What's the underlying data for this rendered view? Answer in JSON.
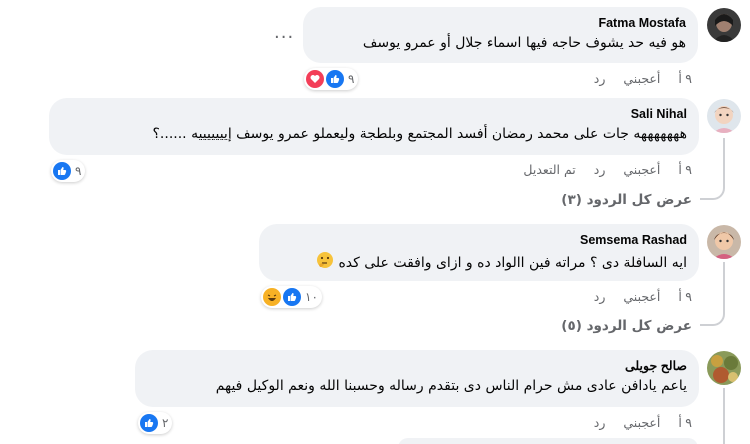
{
  "comments": [
    {
      "author": "Fatma Mostafa",
      "text": "هو فيه حد يشوف حاجه فيها اسماء جلال أو عمرو يوسف",
      "time": "٩ أ",
      "like": "أعجبني",
      "reply": "رد",
      "reaction_count": "٩",
      "more": "..."
    },
    {
      "author": "Sali Nihal",
      "text": "هههههههه جات على محمد رمضان أفسد المجتمع وبلطجة وليعملو عمرو يوسف إيييييييه ......؟",
      "time": "٩ أ",
      "like": "أعجبني",
      "reply": "رد",
      "edited": "تم التعديل",
      "reaction_count": "٩",
      "view_replies": "عرض كل الردود (٣)"
    },
    {
      "author": "Semsema Rashad",
      "text": "ايه السافلة دى ؟ مراته فين االواد ده و ازاى وافقت على كده",
      "time": "٩ أ",
      "like": "أعجبني",
      "reply": "رد",
      "reaction_count": "١٠",
      "view_replies": "عرض كل الردود (٥)"
    },
    {
      "author": "صالح جويلى",
      "text": "ياعم يادافن عادى مش حرام الناس دى بتقدم رساله وحسبنا الله ونعم الوكيل فيهم",
      "time": "٩ أ",
      "like": "أعجبني",
      "reply": "رد",
      "reaction_count": "٢"
    }
  ],
  "colors": {
    "bubble": "#f0f2f5",
    "like_blue": "#1877f2",
    "heart_red": "#f33e58",
    "meta_gray": "#65676b"
  },
  "icons": [
    "like-icon",
    "heart-icon",
    "haha-icon",
    "thinking-emoji-icon",
    "more-options-icon"
  ]
}
